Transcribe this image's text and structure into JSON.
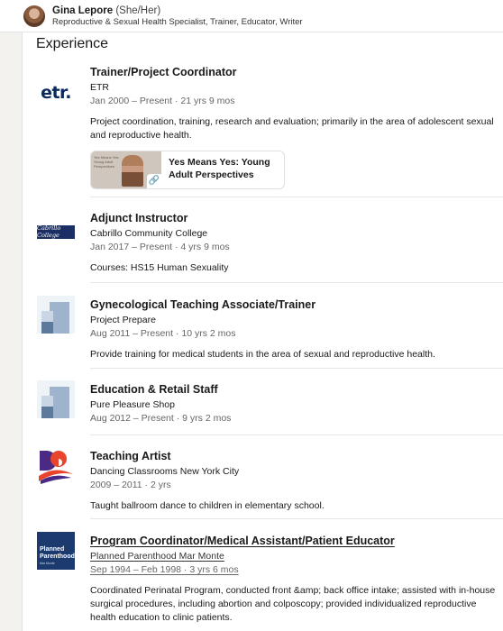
{
  "profile": {
    "name": "Gina Lepore",
    "pronouns": "(She/Her)",
    "headline": "Reproductive & Sexual Health Specialist, Trainer, Educator, Writer"
  },
  "section": {
    "title": "Experience"
  },
  "experience": [
    {
      "role": "Trainer/Project Coordinator",
      "org": "ETR",
      "dates": "Jan 2000 – Present · 21 yrs 9 mos",
      "description": "Project coordination, training, research and evaluation; primarily in the area of adolescent sexual and reproductive health.",
      "logo_text": "etr.",
      "media": {
        "title": "Yes Means Yes: Young Adult Perspectives",
        "thumb_text": "Yes Means Yes: Young Adult Perspectives",
        "icon": "link-icon"
      }
    },
    {
      "role": "Adjunct Instructor",
      "org": "Cabrillo Community College",
      "dates": "Jan 2017 – Present · 4 yrs 9 mos",
      "description": "Courses: HS15 Human Sexuality",
      "logo_text": "Cabrillo College"
    },
    {
      "role": "Gynecological Teaching Associate/Trainer",
      "org": "Project Prepare",
      "dates": "Aug 2011 – Present · 10 yrs 2 mos",
      "description": "Provide training for medical students in the area of sexual and reproductive health."
    },
    {
      "role": "Education & Retail Staff",
      "org": "Pure Pleasure Shop",
      "dates": "Aug 2012 – Present · 9 yrs 2 mos"
    },
    {
      "role": "Teaching Artist",
      "org": "Dancing Classrooms New York City",
      "dates": "2009 – 2011 · 2 yrs",
      "description": "Taught ballroom dance to children in elementary school."
    },
    {
      "role": "Program Coordinator/Medical Assistant/Patient Educator",
      "org": "Planned Parenthood Mar Monte",
      "dates": "Sep 1994 – Feb 1998 · 3 yrs 6 mos",
      "description": "Coordinated Perinatal Program, conducted front &amp; back office intake; assisted with in-house surgical procedures, including abortion and colposcopy; provided individualized reproductive health education to clinic patients.",
      "logo_text": "Planned Parenthood",
      "logo_subtext": "Mar Monte"
    }
  ],
  "colors": {
    "etr_logo": "#0b2a5b",
    "cabrillo_logo": "#1b2f64",
    "dancing_logo_red": "#e8452c",
    "dancing_logo_purple": "#4b2a86",
    "pp_logo": "#1c3a6e"
  }
}
